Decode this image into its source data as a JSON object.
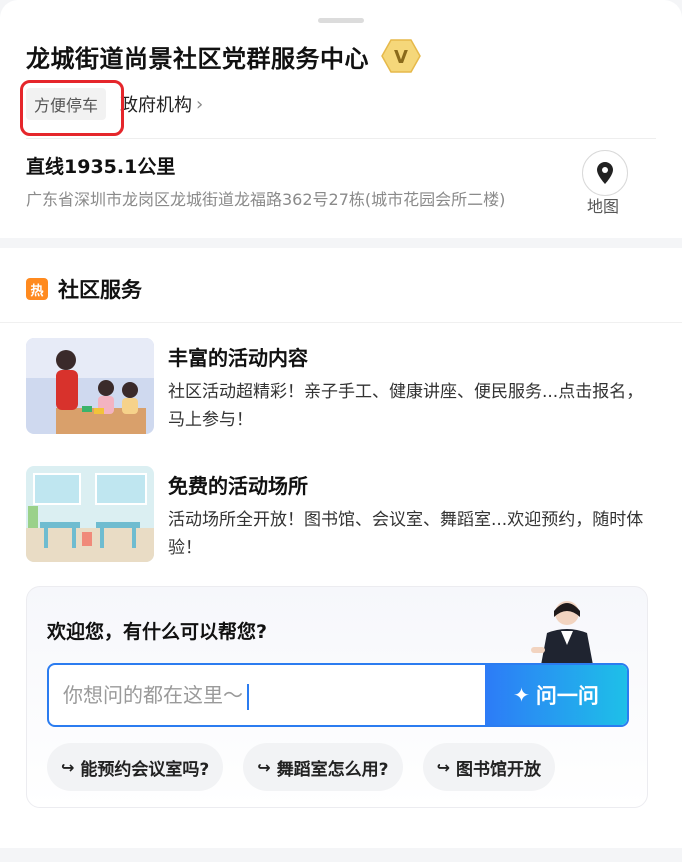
{
  "place": {
    "title": "龙城街道尚景社区党群服务中心",
    "badge_letter": "V",
    "tag": "方便停车",
    "category_link": "政府机构",
    "distance": "直线1935.1公里",
    "address": "广东省深圳市龙岗区龙城街道龙福路362号27栋(城市花园会所二楼)",
    "map_label": "地图"
  },
  "section": {
    "hot_icon": "热",
    "title": "社区服务"
  },
  "services": [
    {
      "title": "丰富的活动内容",
      "desc": "社区活动超精彩！亲子手工、健康讲座、便民服务...点击报名，马上参与！"
    },
    {
      "title": "免费的活动场所",
      "desc": "活动场所全开放！图书馆、会议室、舞蹈室...欢迎预约，随时体验！"
    }
  ],
  "assistant": {
    "greeting": "欢迎您，有什么可以帮您?",
    "placeholder": "你想问的都在这里～",
    "ask_button": "问一问",
    "chips": [
      "能预约会议室吗?",
      "舞蹈室怎么用?",
      "图书馆开放"
    ]
  },
  "colors": {
    "accent_blue": "#2b7cf0",
    "hot_orange": "#ff8a1f",
    "highlight_red": "#e5262b"
  }
}
